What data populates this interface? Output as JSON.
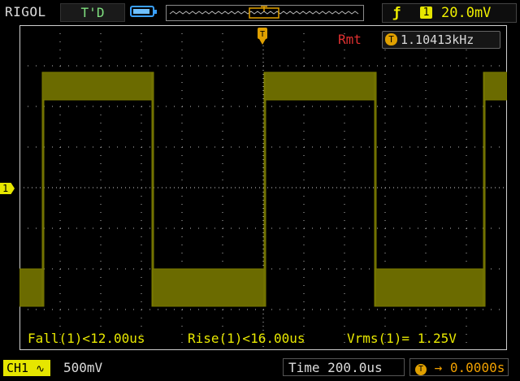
{
  "header": {
    "brand": "RIGOL",
    "trigger_status": "T'D",
    "battery_icon": "battery-icon",
    "trigger_edge_icon": "rising-edge-icon",
    "trigger_channel": "1",
    "trigger_level": "20.0mV"
  },
  "screen": {
    "rmt_label": "Rmt",
    "frequency_badge": "T",
    "frequency": "1.10413kHz",
    "channel_marker": "1"
  },
  "measurements": {
    "fall": "Fall(1)<12.00us",
    "rise": "Rise(1)<16.00us",
    "vrms": "Vrms(1)= 1.25V"
  },
  "footer": {
    "ch1_label": "CH1",
    "ch1_coupling_icon": "ac-coupling-icon",
    "ch1_scale": "500mV",
    "timebase": "Time 200.0us",
    "trigger_offset": "→ 0.0000s"
  },
  "colors": {
    "trace": "#6b6b00",
    "grid": "#bdbdbd",
    "accent": "#e6e600"
  }
}
